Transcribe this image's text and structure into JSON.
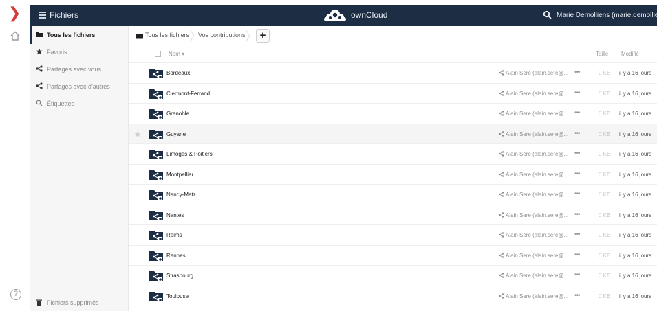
{
  "header": {
    "app_title": "Fichiers",
    "brand": "ownCloud",
    "user": "Marie Demolliens (marie.demolliens@uca.fr)"
  },
  "sidebar": {
    "items": [
      {
        "label": "Tous les fichiers",
        "icon": "folder-icon",
        "active": true
      },
      {
        "label": "Favoris",
        "icon": "star-icon",
        "active": false
      },
      {
        "label": "Partagés avec vous",
        "icon": "share-icon",
        "active": false
      },
      {
        "label": "Partagés avec d'autres",
        "icon": "share-icon",
        "active": false
      },
      {
        "label": "Étiquettes",
        "icon": "search-icon",
        "active": false
      }
    ],
    "trash_label": "Fichiers supprimés"
  },
  "breadcrumb": {
    "root": "Tous les fichiers",
    "current": "Vos contributions",
    "add_label": "+"
  },
  "table": {
    "headers": {
      "name": "Nom",
      "size": "Taille",
      "modified": "Modifié"
    },
    "rows": [
      {
        "name": "Bordeaux",
        "shared_with": "Alain Sere (alain.sere@...",
        "size": "0 KB",
        "modified": "il y a 16 jours"
      },
      {
        "name": "Clermont-Ferrand",
        "shared_with": "Alain Sere (alain.sere@...",
        "size": "0 KB",
        "modified": "il y a 16 jours"
      },
      {
        "name": "Grenoble",
        "shared_with": "Alain Sere (alain.sere@...",
        "size": "0 KB",
        "modified": "il y a 16 jours"
      },
      {
        "name": "Guyane",
        "shared_with": "Alain Sere (alain.sere@...",
        "size": "0 KB",
        "modified": "il y a 16 jours"
      },
      {
        "name": "Limoges & Poitiers",
        "shared_with": "Alain Sere (alain.sere@...",
        "size": "0 KB",
        "modified": "il y a 16 jours"
      },
      {
        "name": "Montpellier",
        "shared_with": "Alain Sere (alain.sere@...",
        "size": "0 KB",
        "modified": "il y a 16 jours"
      },
      {
        "name": "Nancy-Metz",
        "shared_with": "Alain Sere (alain.sere@...",
        "size": "0 KB",
        "modified": "il y a 16 jours"
      },
      {
        "name": "Nantes",
        "shared_with": "Alain Sere (alain.sere@...",
        "size": "0 KB",
        "modified": "il y a 16 jours"
      },
      {
        "name": "Reims",
        "shared_with": "Alain Sere (alain.sere@...",
        "size": "0 KB",
        "modified": "il y a 16 jours"
      },
      {
        "name": "Rennes",
        "shared_with": "Alain Sere (alain.sere@...",
        "size": "0 KB",
        "modified": "il y a 16 jours"
      },
      {
        "name": "Strasbourg",
        "shared_with": "Alain Sere (alain.sere@...",
        "size": "0 KB",
        "modified": "il y a 16 jours"
      },
      {
        "name": "Toulouse",
        "shared_with": "Alain Sere (alain.sere@...",
        "size": "0 KB",
        "modified": "il y a 16 jours"
      }
    ]
  },
  "colors": {
    "header_bg": "#1d2d44",
    "folder": "#1d2d44",
    "accent_red": "#d33a3a"
  }
}
